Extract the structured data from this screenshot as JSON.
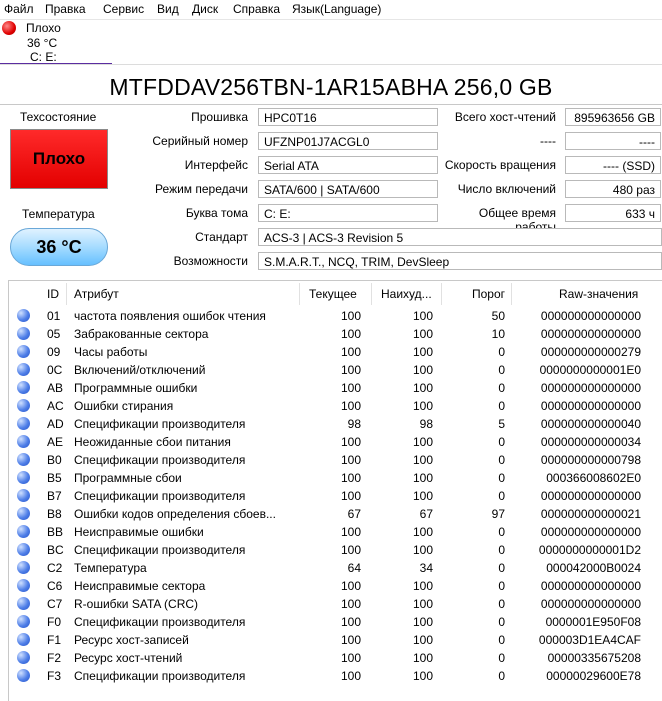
{
  "menu": [
    "Файл",
    "Правка",
    "Сервис",
    "Вид",
    "Диск",
    "Справка",
    "Язык(Language)"
  ],
  "drive_tab": {
    "status": "Плохо",
    "temp": "36 °C",
    "letters": "C: E:"
  },
  "model_title": "MTFDDAV256TBN-1AR15ABHA 256,0 GB",
  "health": {
    "label": "Техсостояние",
    "value": "Плохо",
    "color": "#ff1a1a"
  },
  "temperature": {
    "label": "Температура",
    "value": "36 °C",
    "color": "#8fd0ff"
  },
  "info_middle": [
    {
      "label": "Прошивка",
      "value": "HPC0T16"
    },
    {
      "label": "Серийный номер",
      "value": "UFZNP01J7ACGL0"
    },
    {
      "label": "Интерфейс",
      "value": "Serial ATA"
    },
    {
      "label": "Режим передачи",
      "value": "SATA/600 | SATA/600"
    },
    {
      "label": "Буква тома",
      "value": "C: E:"
    }
  ],
  "info_right": [
    {
      "label": "Всего хост-чтений",
      "value": "895963656 GB"
    },
    {
      "label": "----",
      "value": "----"
    },
    {
      "label": "Скорость вращения",
      "value": "---- (SSD)"
    },
    {
      "label": "Число включений",
      "value": "480 раз"
    },
    {
      "label": "Общее время работы",
      "value": "633 ч"
    }
  ],
  "standard": {
    "label": "Стандарт",
    "value": "ACS-3 | ACS-3 Revision 5"
  },
  "features": {
    "label": "Возможности",
    "value": "S.M.A.R.T., NCQ, TRIM, DevSleep"
  },
  "smart": {
    "headers": [
      "ID",
      "Атрибут",
      "Текущее",
      "Наихуд...",
      "Порог",
      "Raw-значения"
    ],
    "rows": [
      {
        "id": "01",
        "name": "частота появления ошибок чтения",
        "cur": "100",
        "worst": "100",
        "thr": "50",
        "raw": "000000000000000"
      },
      {
        "id": "05",
        "name": "Забракованные сектора",
        "cur": "100",
        "worst": "100",
        "thr": "10",
        "raw": "000000000000000"
      },
      {
        "id": "09",
        "name": "Часы работы",
        "cur": "100",
        "worst": "100",
        "thr": "0",
        "raw": "000000000000279"
      },
      {
        "id": "0C",
        "name": "Включений/отключений",
        "cur": "100",
        "worst": "100",
        "thr": "0",
        "raw": "0000000000001E0"
      },
      {
        "id": "AB",
        "name": "Программные ошибки",
        "cur": "100",
        "worst": "100",
        "thr": "0",
        "raw": "000000000000000"
      },
      {
        "id": "AC",
        "name": "Ошибки стирания",
        "cur": "100",
        "worst": "100",
        "thr": "0",
        "raw": "000000000000000"
      },
      {
        "id": "AD",
        "name": "Спецификации производителя",
        "cur": "98",
        "worst": "98",
        "thr": "5",
        "raw": "000000000000040"
      },
      {
        "id": "AE",
        "name": "Неожиданные сбои питания",
        "cur": "100",
        "worst": "100",
        "thr": "0",
        "raw": "000000000000034"
      },
      {
        "id": "B0",
        "name": "Спецификации производителя",
        "cur": "100",
        "worst": "100",
        "thr": "0",
        "raw": "000000000000798"
      },
      {
        "id": "B5",
        "name": "Программные сбои",
        "cur": "100",
        "worst": "100",
        "thr": "0",
        "raw": "000366008602E0"
      },
      {
        "id": "B7",
        "name": "Спецификации производителя",
        "cur": "100",
        "worst": "100",
        "thr": "0",
        "raw": "000000000000000"
      },
      {
        "id": "B8",
        "name": "Ошибки кодов определения сбоев...",
        "cur": "67",
        "worst": "67",
        "thr": "97",
        "raw": "000000000000021"
      },
      {
        "id": "BB",
        "name": "Неисправимые ошибки",
        "cur": "100",
        "worst": "100",
        "thr": "0",
        "raw": "000000000000000"
      },
      {
        "id": "BC",
        "name": "Спецификации производителя",
        "cur": "100",
        "worst": "100",
        "thr": "0",
        "raw": "0000000000001D2"
      },
      {
        "id": "C2",
        "name": "Температура",
        "cur": "64",
        "worst": "34",
        "thr": "0",
        "raw": "000042000B0024"
      },
      {
        "id": "C6",
        "name": "Неисправимые сектора",
        "cur": "100",
        "worst": "100",
        "thr": "0",
        "raw": "000000000000000"
      },
      {
        "id": "C7",
        "name": "R-ошибки SATA (CRC)",
        "cur": "100",
        "worst": "100",
        "thr": "0",
        "raw": "000000000000000"
      },
      {
        "id": "F0",
        "name": "Спецификации производителя",
        "cur": "100",
        "worst": "100",
        "thr": "0",
        "raw": "0000001E950F08"
      },
      {
        "id": "F1",
        "name": "Ресурс хост-записей",
        "cur": "100",
        "worst": "100",
        "thr": "0",
        "raw": "000003D1EA4CAF"
      },
      {
        "id": "F2",
        "name": "Ресурс хост-чтений",
        "cur": "100",
        "worst": "100",
        "thr": "0",
        "raw": "00000335675208"
      },
      {
        "id": "F3",
        "name": "Спецификации производителя",
        "cur": "100",
        "worst": "100",
        "thr": "0",
        "raw": "00000029600E78"
      }
    ]
  }
}
